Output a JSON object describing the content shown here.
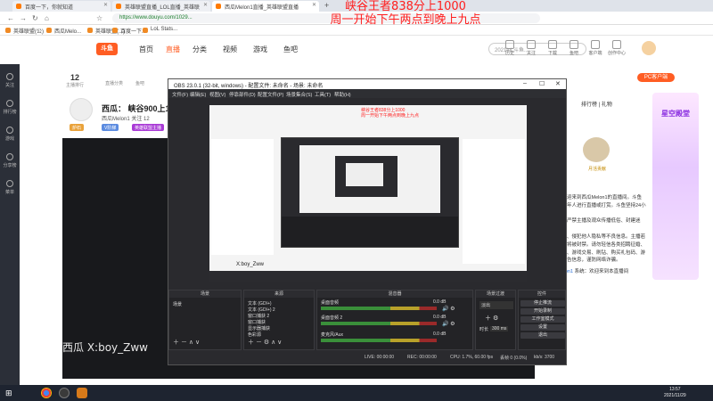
{
  "browser": {
    "tabs": [
      {
        "label": "百度一下，你就知道"
      },
      {
        "label": "英雄联盟直播_LOL直播_英雄联"
      },
      {
        "label": "西瓜Melon1直播_英雄联盟直播"
      }
    ],
    "url": "https://www.douyu.com/1029...",
    "bookmarks": [
      "英雄联盟(公)",
      "西瓜Melo...",
      "英雄联盟(...)",
      "百度一下...",
      "LoL Stats..."
    ]
  },
  "announcement": {
    "line1": "峡谷王者838分上1000",
    "line2": "周一开始下午两点到晚上九点"
  },
  "douyu": {
    "logo": "斗鱼",
    "nav": [
      "首页",
      "直播",
      "分类",
      "视频",
      "游戏",
      "鱼吧"
    ],
    "active_nav": "直播",
    "search_placeholder": "2021lol.斗鱼...",
    "nav_icons": [
      "历史",
      "关注",
      "下载",
      "鱼吧",
      "客户端",
      "创作中心"
    ],
    "pc_button": "PC客户端",
    "sidebar": [
      "关注",
      "排行榜",
      "游戏",
      "分享榜",
      "菜单"
    ],
    "room": {
      "count": "12",
      "count_label": "主播排行",
      "cat_tabs": [
        "直播分类",
        "鱼吧"
      ],
      "title": "西瓜：  峡谷900上1000",
      "subtitle": "西瓜Melon1   关注 12",
      "badges": [
        "炉石",
        "V阶梯",
        "英雄联盟主播"
      ]
    },
    "rank_title": "排行榜 | 礼物",
    "rank_text": "月活贡献",
    "promo_title": "星空殿堂",
    "chat_lines": [
      "系统：欢迎来到西瓜Melon1的直播间。斗鱼",
      "严禁未成年人进行直播或打赏。斗鱼坚持24小时在",
      "线巡查，严禁主播及观众传播低俗、封建迷信、",
      "暴力血腥、侵犯他人隐私等不良信息。主播若",
      "涉及违规将被封禁。请勿轻信各类招聘征婚、",
      "代练代充、游戏交易、刷钻、购买礼包码、游",
      "戏币等广告信息，谨防网络诈骗。",
      "系统：欢迎来到本直播间"
    ],
    "chat_highlight": "西瓜Melon1",
    "overlay_watermark": "西瓜   X:boy_Zww"
  },
  "obs": {
    "title": "OBS 23.0.1 (32-bit, windows) - 配置文件: 未命名 - 场景: 未命名",
    "menu": [
      "文件(F)",
      "编辑(E)",
      "视图(V)",
      "停靠部件(D)",
      "配置文件(P)",
      "场景集合(S)",
      "工具(T)",
      "帮助(H)"
    ],
    "inner_red_1": "峡谷王者838分上1000",
    "inner_red_2": "周一开始下午两点到晚上九点",
    "inner_watermark": "X:boy_Zww",
    "docks": {
      "scenes": {
        "header": "场景",
        "items": [
          "场景"
        ]
      },
      "sources": {
        "header": "来源",
        "items": [
          "文本 (GDI+)",
          "文本 (GDI+) 2",
          "窗口捕获 2",
          "窗口捕获",
          "显示器捕获",
          "色彩源"
        ]
      },
      "mixer": {
        "header": "混音器",
        "tracks": [
          "桌面音频",
          "桌面音频 2",
          "麦克风/Aux"
        ],
        "levels": [
          "0.0 dB",
          "0.0 dB",
          "0.0 dB"
        ]
      },
      "transitions": {
        "header": "场景过渡",
        "type": "淡出",
        "duration_label": "时长",
        "duration": "300 ms"
      },
      "controls": {
        "header": "控件",
        "buttons": [
          "停止推流",
          "开始录制",
          "工作室模式",
          "设置",
          "退出"
        ]
      }
    },
    "status": {
      "live": "LIVE: 00:00:00",
      "rec": "REC: 00:00:00",
      "cpu": "CPU: 1.7%, 60.00 fps",
      "dropped": "丢帧 0 (0.0%)",
      "kbps": "kb/s: 3700"
    }
  },
  "taskbar": {
    "time": "13:57",
    "date": "2021/11/29"
  }
}
